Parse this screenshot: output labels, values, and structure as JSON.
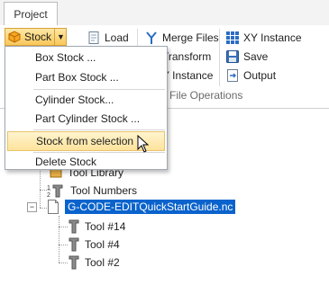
{
  "tabs": [
    {
      "label": "Project"
    }
  ],
  "ribbon": {
    "stock_label": "Stock",
    "load_label": "Load",
    "merge_files_label": "Merge Files",
    "transform_label": "Transform",
    "xy_instance_label": "XY Instance",
    "xy_instance_partial_label": "Y Instance",
    "save_label": "Save",
    "output_label": "Output",
    "group_label": "File Operations"
  },
  "stock_menu": {
    "items": [
      {
        "label": "Box Stock ..."
      },
      {
        "label": "Part Box Stock ..."
      },
      {
        "label": "Cylinder Stock..."
      },
      {
        "label": "Part Cylinder Stock ..."
      },
      {
        "label": "Stock from selection"
      },
      {
        "label": "Delete Stock"
      }
    ],
    "hovered_index": 4
  },
  "tree": {
    "tool_library_label": "Tool Library",
    "tool_numbers_label": "Tool Numbers",
    "file_label": "G-CODE-EDITQuickStartGuide.nc",
    "expander_symbol": "−",
    "tools": [
      {
        "label": "Tool #14"
      },
      {
        "label": "Tool #4"
      },
      {
        "label": "Tool #2"
      }
    ]
  },
  "colors": {
    "selection": "#0a63cc",
    "hover_fill": "#fde39b",
    "stock_button": "#f9c75a"
  }
}
